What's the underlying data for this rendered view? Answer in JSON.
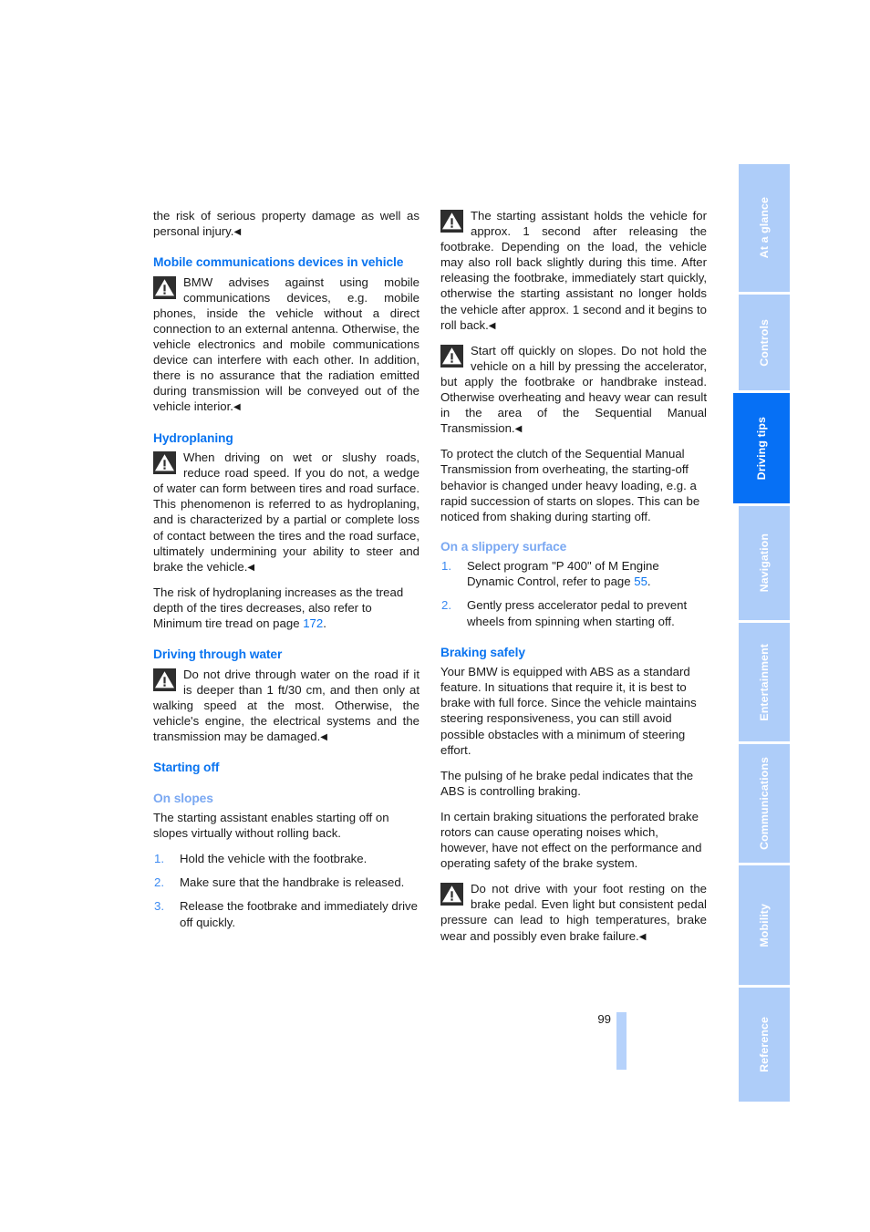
{
  "page": {
    "number": "99",
    "accent_blue": "#0a74f0",
    "subhead_blue": "#7aa8f2",
    "list_number_blue": "#3d8bf2",
    "tab_inactive_bg": "#aecdf9",
    "tab_active_bg": "#0670f5",
    "page_bar_color": "#b6d2fb"
  },
  "left_column": {
    "carryover_paragraph": "the risk of serious property damage as well as personal injury.",
    "sections": [
      {
        "heading": "Mobile communications devices in vehicle",
        "warning": "BMW advises against using mobile communications devices, e.g. mobile phones, inside the vehicle without a direct connection to an external antenna. Otherwise, the vehicle electronics and mobile communications device can interfere with each other. In addition, there is no assurance that the radiation emitted during transmission will be conveyed out of the vehicle interior."
      },
      {
        "heading": "Hydroplaning",
        "warning": "When driving on wet or slushy roads, reduce road speed. If you do not, a wedge of water can form between tires and road surface. This phenomenon is referred to as hydroplaning, and is characterized by a partial or complete loss of contact between the tires and the road surface, ultimately undermining your ability to steer and brake the vehicle.",
        "paragraph_before_link": "The risk of hydroplaning increases as the tread depth of the tires decreases, also refer to Minimum tire tread on page ",
        "page_link": "172",
        "paragraph_after_link": "."
      },
      {
        "heading": "Driving through water",
        "warning": "Do not drive through water on the road if it is deeper than 1 ft/30 cm, and then only at walking speed at the most. Otherwise, the vehicle's engine, the electrical systems and the transmission may be damaged."
      },
      {
        "heading": "Starting off",
        "subheading": "On slopes",
        "intro": "The starting assistant enables starting off on slopes virtually without rolling back.",
        "steps": [
          {
            "num": "1.",
            "text": "Hold the vehicle with the footbrake."
          },
          {
            "num": "2.",
            "text": "Make sure that the handbrake is released."
          },
          {
            "num": "3.",
            "text": "Release the footbrake and immediately drive off quickly."
          }
        ]
      }
    ]
  },
  "right_column": {
    "warning_1": "The starting assistant holds the vehicle for approx. 1 second after releasing the footbrake. Depending on the load, the vehicle may also roll back slightly during this time. After releasing the footbrake, immediately start quickly, otherwise the starting assistant no longer holds the vehicle after approx. 1 second and it begins to roll back.",
    "warning_2": "Start off quickly on slopes. Do not hold the vehicle on a hill by pressing the accelerator, but apply the footbrake or handbrake instead. Otherwise overheating and heavy wear can result in the area of the Sequential Manual Transmission.",
    "paragraph_clutch": "To protect the clutch of the Sequential Manual Transmission from overheating, the starting-off behavior is changed under heavy loading, e.g. a rapid succession of starts on slopes. This can be noticed from shaking during starting off.",
    "slippery": {
      "subheading": "On a slippery surface",
      "steps": [
        {
          "num": "1.",
          "text_before_link": "Select program \"P 400\" of M Engine Dynamic Control, refer to page ",
          "page_link": "55",
          "text_after_link": "."
        },
        {
          "num": "2.",
          "text": "Gently press accelerator pedal to prevent wheels from spinning when starting off."
        }
      ]
    },
    "braking": {
      "heading": "Braking safely",
      "paragraph_1": "Your BMW is equipped with ABS as a standard feature. In situations that require it, it is best to brake with full force. Since the vehicle maintains steering responsiveness, you can still avoid possible obstacles with a minimum of steering effort.",
      "paragraph_2": "The pulsing of he brake pedal indicates that the ABS is controlling braking.",
      "paragraph_3": "In certain braking situations the perforated brake rotors can cause operating noises which, however, have not effect on the performance and operating safety of the brake system.",
      "warning": "Do not drive with your foot resting on the brake pedal. Even light but consistent pedal pressure can lead to high temperatures, brake wear and possibly even brake failure."
    }
  },
  "tabs": [
    {
      "label": "At a glance",
      "active": false
    },
    {
      "label": "Controls",
      "active": false
    },
    {
      "label": "Driving tips",
      "active": true
    },
    {
      "label": "Navigation",
      "active": false
    },
    {
      "label": "Entertainment",
      "active": false
    },
    {
      "label": "Communications",
      "active": false
    },
    {
      "label": "Mobility",
      "active": false
    },
    {
      "label": "Reference",
      "active": false
    }
  ],
  "icons": {
    "warning_triangle": "warning-triangle-icon",
    "end_of_warning": "◀"
  }
}
